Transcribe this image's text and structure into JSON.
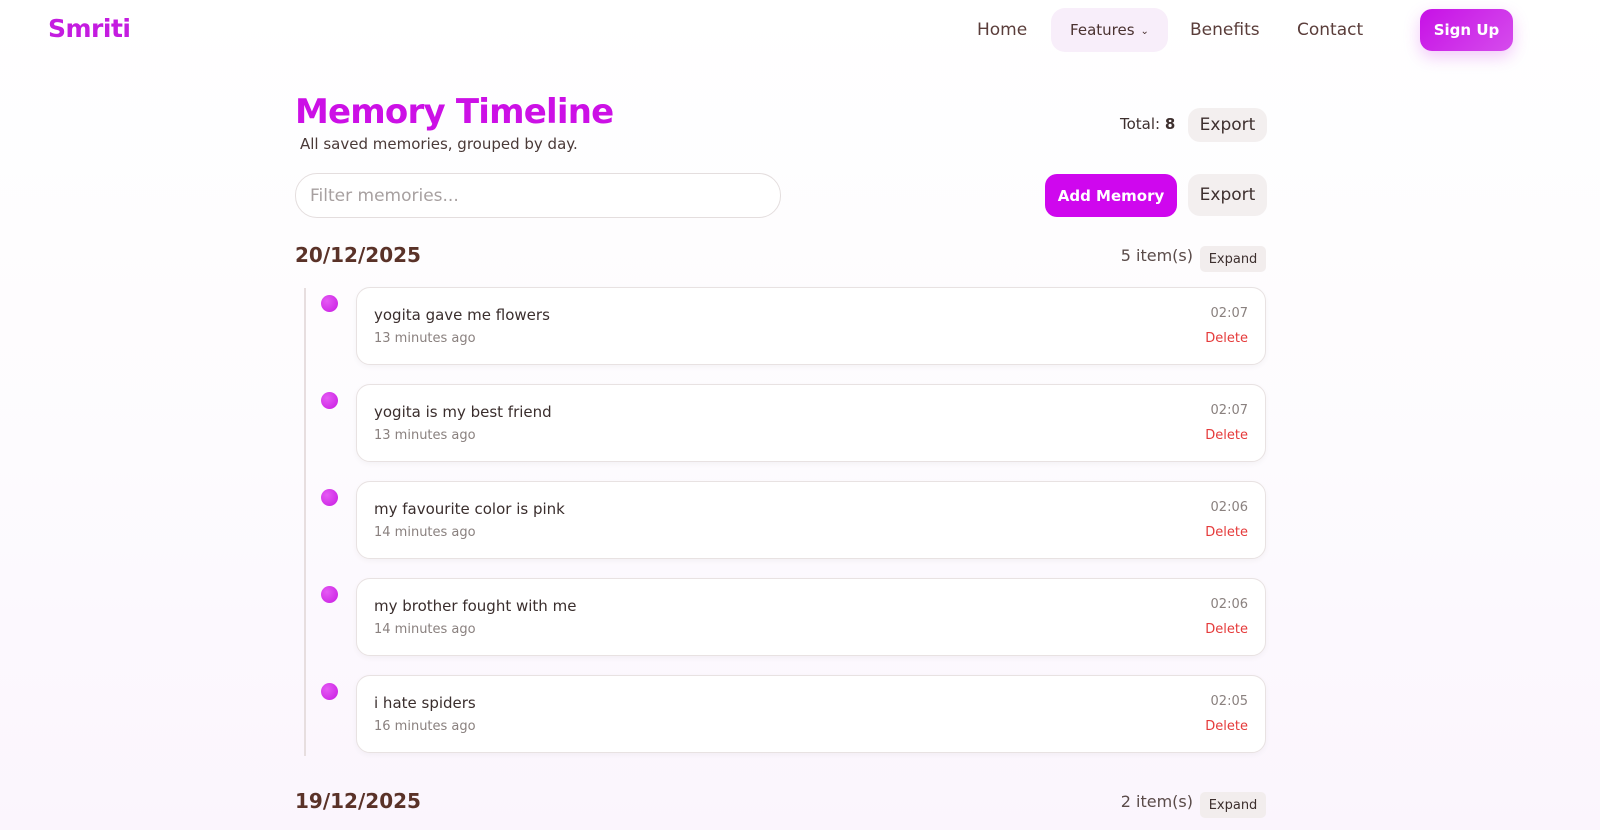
{
  "brand": {
    "name": "Smriti",
    "accent": "#cc10e6"
  },
  "nav": {
    "home": "Home",
    "features": "Features",
    "benefits": "Benefits",
    "contact": "Contact",
    "signup": "Sign Up"
  },
  "header": {
    "title": "Memory Timeline",
    "subtitle": "All saved memories, grouped by day.",
    "total_label": "Total:",
    "total_value": "8",
    "export_label": "Export"
  },
  "toolbar": {
    "filter_placeholder": "Filter memories...",
    "add_label": "Add Memory",
    "export_label": "Export"
  },
  "groups": [
    {
      "date": "20/12/2025",
      "count": "5 item(s)",
      "expand_label": "Expand",
      "items": [
        {
          "text": "yogita gave me flowers",
          "ago": "13 minutes ago",
          "time": "02:07",
          "delete": "Delete"
        },
        {
          "text": "yogita is my best friend",
          "ago": "13 minutes ago",
          "time": "02:07",
          "delete": "Delete"
        },
        {
          "text": "my favourite color is pink",
          "ago": "14 minutes ago",
          "time": "02:06",
          "delete": "Delete"
        },
        {
          "text": "my brother fought with me",
          "ago": "14 minutes ago",
          "time": "02:06",
          "delete": "Delete"
        },
        {
          "text": "i hate spiders",
          "ago": "16 minutes ago",
          "time": "02:05",
          "delete": "Delete"
        }
      ]
    },
    {
      "date": "19/12/2025",
      "count": "2 item(s)",
      "expand_label": "Expand"
    }
  ]
}
